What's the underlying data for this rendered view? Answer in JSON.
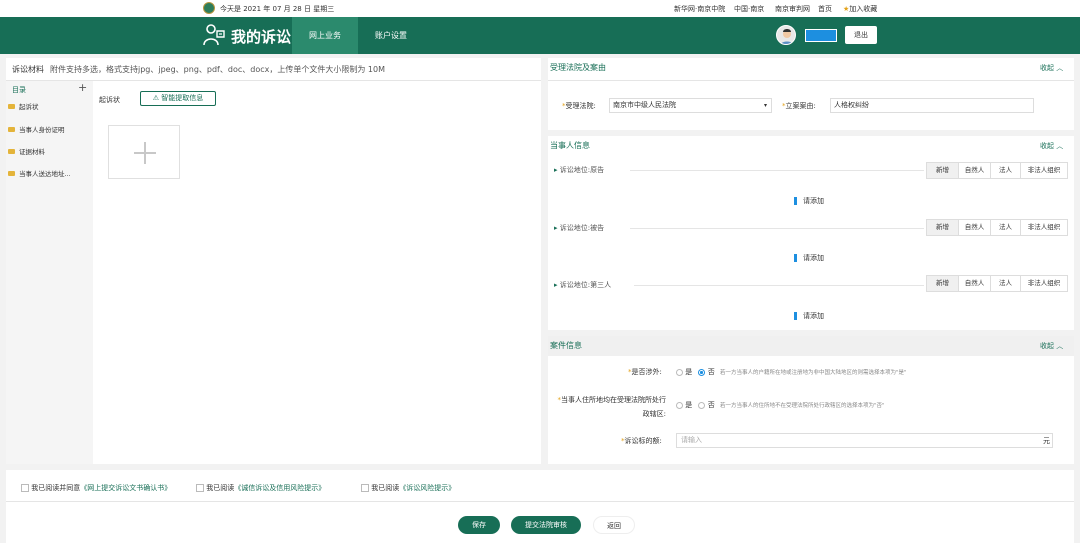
{
  "topbar": {
    "date_text": "今天是 2021 年 07 月 28 日 星期三",
    "links": [
      "新华网·南京中院",
      "中国·南京",
      "南京审判网",
      "首页"
    ],
    "favorite": "加入收藏"
  },
  "header": {
    "title": "我的诉讼",
    "nav": [
      "网上业务",
      "账户设置"
    ],
    "logout": "退出"
  },
  "upload": {
    "title": "诉讼材料",
    "note": "附件支持多选，格式支持jpg、jpeg、png、pdf、doc、docx，上传单个文件大小限制为 10M",
    "dir_title": "目录",
    "dir_add": "+",
    "dir_items": [
      "起诉状",
      "当事人身份证明",
      "证据材料",
      "当事人送达地址..."
    ],
    "section_label": "起诉状",
    "smart_button": "智能提取信息"
  },
  "court": {
    "title": "受理法院及案由",
    "collapse": "收起",
    "court_label": "受理法院:",
    "court_value": "南京市中级人民法院",
    "cause_label": "立案案由:",
    "cause_value": "人格权纠纷"
  },
  "parties": {
    "title": "当事人信息",
    "collapse": "收起",
    "rows": [
      {
        "label": "诉讼地位:",
        "role": "原告"
      },
      {
        "label": "诉讼地位:",
        "role": "被告"
      },
      {
        "label": "诉讼地位:",
        "role": "第三人"
      }
    ],
    "buttons": [
      "新增",
      "自然人",
      "法人",
      "非法人组织"
    ],
    "add_hint": "请添加"
  },
  "caseinfo": {
    "title": "案件信息",
    "collapse": "收起",
    "foreign_label": "是否涉外:",
    "yes": "是",
    "no": "否",
    "foreign_hint": "若一方当事人的户籍所在地或注册地为非中国大陆地区的则需选择本项为\"是\"",
    "residence_label": "当事人住所地均在受理法院所处行政辖区:",
    "residence_hint": "若一方当事人的住所地不在受理法院所处行政辖区的选择本项为\"否\"",
    "amount_label": "诉讼标的额:",
    "amount_placeholder": "请输入",
    "amount_unit": "元"
  },
  "bottom": {
    "agree1_prefix": "我已阅读并同意",
    "agree1_link": "《网上提交诉讼文书确认书》",
    "agree2_prefix": "我已阅读",
    "agree2_link": "《诚信诉讼及信用风险提示》",
    "agree3_prefix": "我已阅读",
    "agree3_link": "《诉讼风险提示》",
    "save": "保存",
    "submit": "提交法院审核",
    "back": "返回"
  },
  "colors": {
    "brand": "#176e56",
    "accent": "#e3a21a",
    "link": "#1d8fe0"
  }
}
